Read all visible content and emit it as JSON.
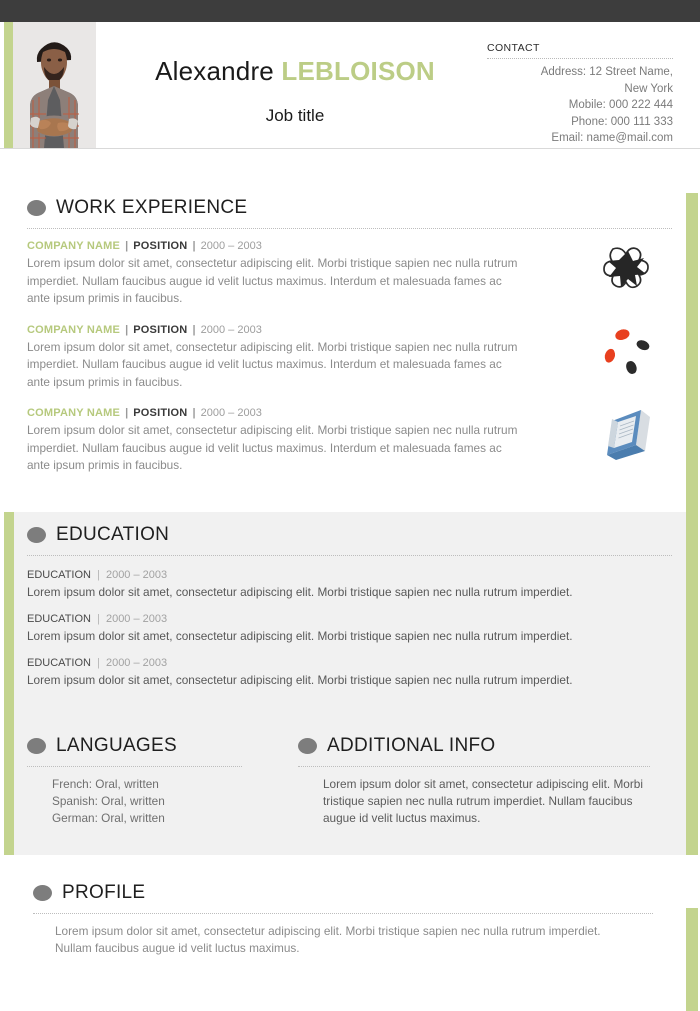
{
  "theme": {
    "accent_green": "#c3d48e",
    "name_accent": "#bccd86",
    "topbar_dark": "#3d3d3d",
    "band_grey": "#f1f1f1",
    "bullet_grey": "#7d7d7d",
    "body_text_grey": "#8b8b8b"
  },
  "header": {
    "photo_alt": "portrait-photo",
    "first_name": "Alexandre",
    "last_name": "LEBLOISON",
    "job_title": "Job title",
    "contact": {
      "title": "CONTACT",
      "lines": [
        "Address: 12 Street Name,",
        "New York",
        "Mobile: 000 222 444",
        "Phone: 000 111 333",
        "Email: name@mail.com"
      ]
    }
  },
  "sections": {
    "work": {
      "title": "WORK EXPERIENCE",
      "entries": [
        {
          "company": "COMPANY NAME",
          "position": "POSITION",
          "dates": "2000 – 2003",
          "separator": "|",
          "description": "Lorem ipsum dolor sit amet, consectetur adipiscing elit. Morbi tristique sapien nec nulla rutrum imperdiet. Nullam faucibus augue id velit luctus maximus. Interdum et malesuada fames ac ante ipsum primis in faucibus.",
          "logo": "star-flower-logo"
        },
        {
          "company": "COMPANY NAME",
          "position": "POSITION",
          "dates": "2000 – 2003",
          "separator": "|",
          "description": "Lorem ipsum dolor sit amet, consectetur adipiscing elit. Morbi tristique sapien nec nulla rutrum imperdiet. Nullam faucibus augue id velit luctus maximus. Interdum et malesuada fames ac ante ipsum primis in faucibus.",
          "logo": "pebble-ring-logo"
        },
        {
          "company": "COMPANY NAME",
          "position": "POSITION",
          "dates": "2000 – 2003",
          "separator": "|",
          "description": "Lorem ipsum dolor sit amet, consectetur adipiscing elit. Morbi tristique sapien nec nulla rutrum imperdiet. Nullam faucibus augue id velit luctus maximus. Interdum et malesuada fames ac ante ipsum primis in faucibus.",
          "logo": "blue-book-logo"
        }
      ]
    },
    "education": {
      "title": "EDUCATION",
      "entries": [
        {
          "label": "EDUCATION",
          "separator": "|",
          "dates": "2000  – 2003",
          "description": "Lorem ipsum dolor sit amet, consectetur adipiscing elit. Morbi tristique sapien nec nulla rutrum imperdiet."
        },
        {
          "label": "EDUCATION",
          "separator": "|",
          "dates": "2000  – 2003",
          "description": "Lorem ipsum dolor sit amet, consectetur adipiscing elit. Morbi tristique sapien nec nulla rutrum imperdiet."
        },
        {
          "label": "EDUCATION",
          "separator": "|",
          "dates": "2000  – 2003",
          "description": "Lorem ipsum dolor sit amet, consectetur adipiscing elit. Morbi tristique sapien nec nulla rutrum imperdiet."
        }
      ]
    },
    "languages": {
      "title": "LANGUAGES",
      "items": [
        "French: Oral, written",
        "Spanish: Oral, written",
        "German: Oral, written"
      ]
    },
    "additional": {
      "title": "ADDITIONAL INFO",
      "text": "Lorem ipsum dolor sit amet, consectetur adipiscing elit. Morbi tristique sapien nec nulla rutrum imperdiet. Nullam faucibus augue id velit luctus maximus."
    },
    "profile": {
      "title": "PROFILE",
      "text": "Lorem ipsum dolor sit amet, consectetur adipiscing elit. Morbi tristique sapien nec nulla rutrum imperdiet. Nullam faucibus augue id velit luctus maximus."
    }
  }
}
